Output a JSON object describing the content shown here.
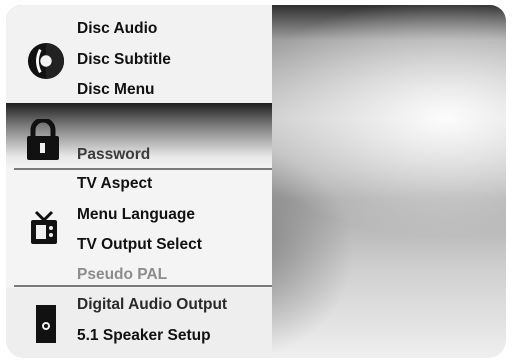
{
  "menu": {
    "disc": {
      "icon": "disc-icon",
      "items": [
        "Disc Audio",
        "Disc Subtitle",
        "Disc Menu"
      ]
    },
    "lock": {
      "icon": "lock-icon",
      "items": [
        "Password"
      ]
    },
    "tv": {
      "icon": "tv-icon",
      "items": [
        "TV Aspect",
        "Menu Language",
        "TV Output Select",
        "Pseudo PAL"
      ]
    },
    "audio": {
      "icon": "speaker-icon",
      "items": [
        "Digital Audio Output",
        "5.1 Speaker Setup"
      ]
    }
  }
}
